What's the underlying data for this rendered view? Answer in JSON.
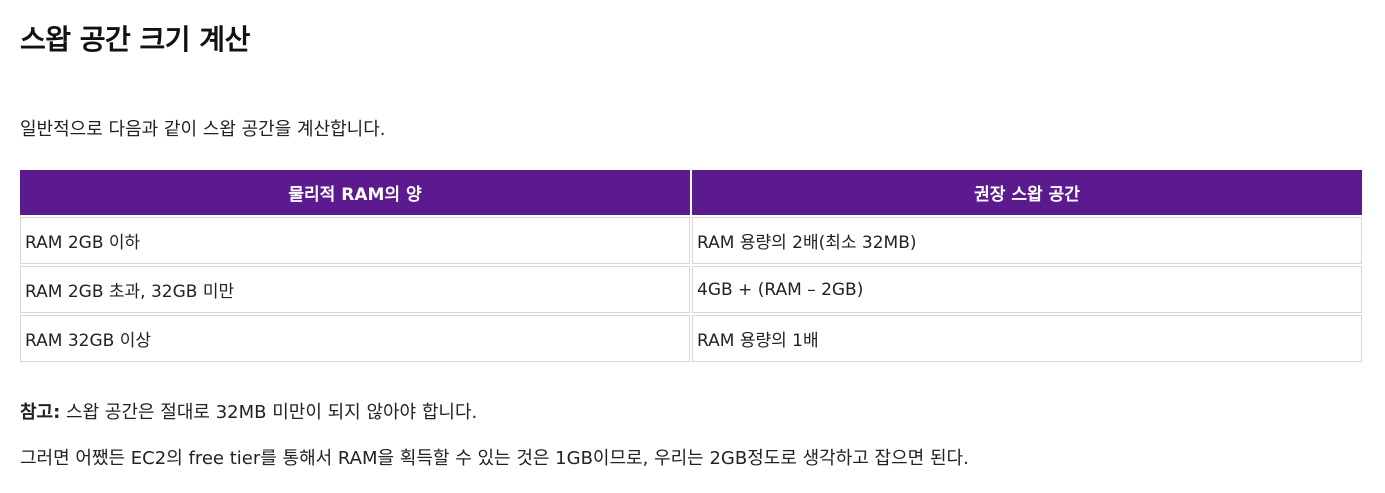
{
  "document": {
    "title": "스왑 공간 크기 계산",
    "intro": "일반적으로 다음과 같이 스왑 공간을 계산합니다.",
    "table": {
      "headers": [
        "물리적 RAM의 양",
        "권장 스왑 공간"
      ],
      "rows": [
        [
          "RAM 2GB 이하",
          "RAM 용량의 2배(최소 32MB)"
        ],
        [
          "RAM 2GB 초과, 32GB 미만",
          "4GB + (RAM – 2GB)"
        ],
        [
          "RAM 32GB 이상",
          "RAM 용량의 1배"
        ]
      ]
    },
    "note": {
      "label": "참고:",
      "text": " 스왑 공간은 절대로 32MB 미만이 되지 않아야 합니다."
    },
    "closing": "그러면 어쨌든 EC2의 free tier를 통해서 RAM을 획득할 수 있는 것은 1GB이므로, 우리는 2GB정도로 생각하고 잡으면 된다."
  },
  "colors": {
    "header_bg": "#5b1a8e",
    "header_text": "#ffffff",
    "cell_border": "#d6d6d6",
    "text": "#222222"
  }
}
